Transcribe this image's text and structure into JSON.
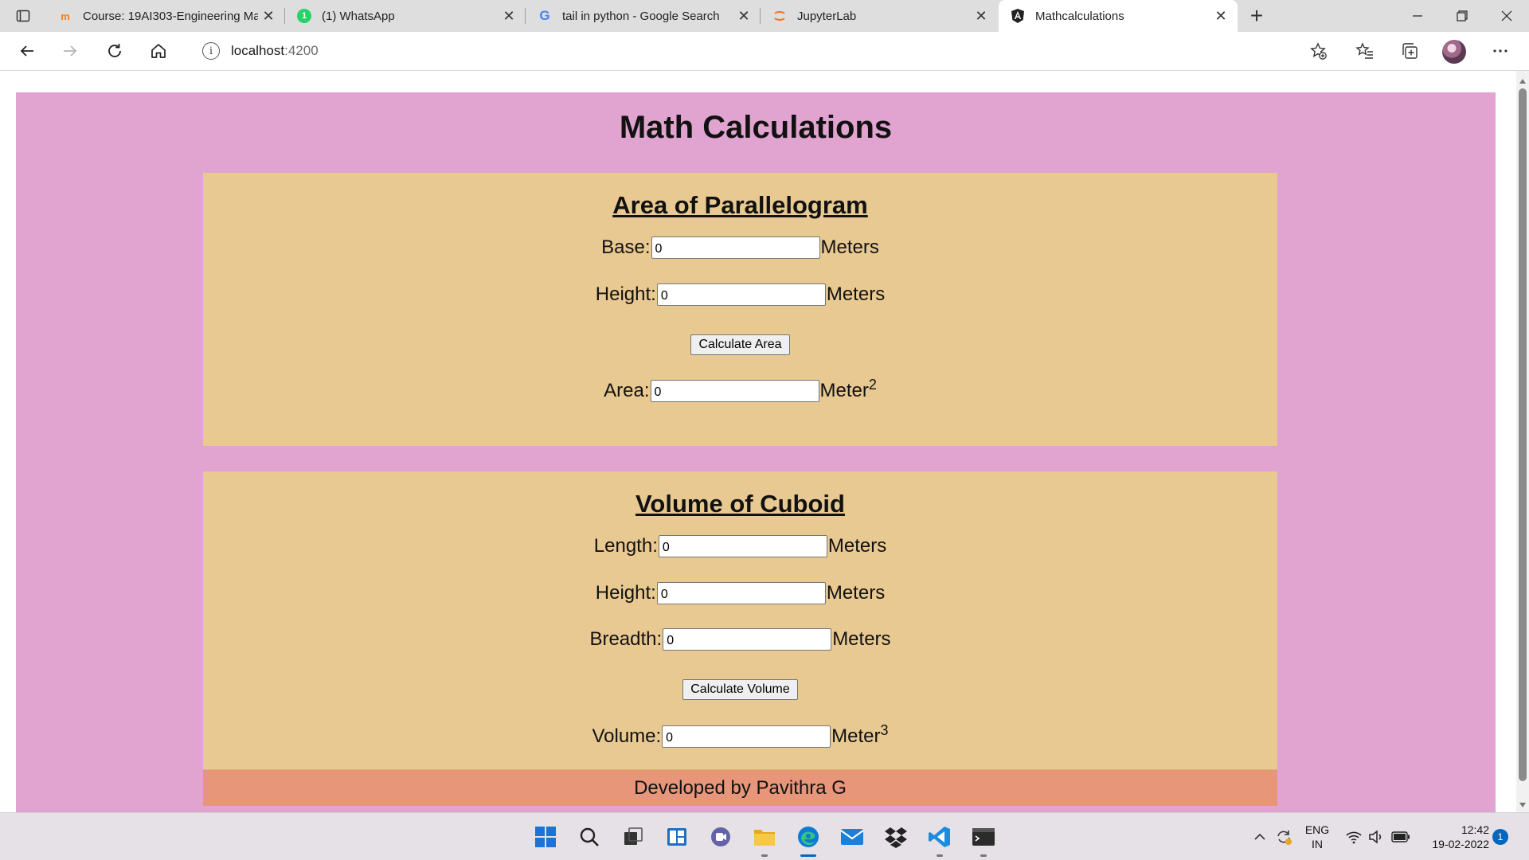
{
  "browser": {
    "tabs": [
      {
        "title": "Course: 19AI303-Engineering Mathematics",
        "favicon": "moodle-icon",
        "active": false
      },
      {
        "title": "(1) WhatsApp",
        "favicon": "whatsapp-icon",
        "active": false
      },
      {
        "title": "tail in python - Google Search",
        "favicon": "google-icon",
        "active": false
      },
      {
        "title": "JupyterLab",
        "favicon": "jupyter-icon",
        "active": false
      },
      {
        "title": "Mathcalculations",
        "favicon": "angular-icon",
        "active": true
      }
    ],
    "address": {
      "host": "localhost",
      "port": ":4200"
    }
  },
  "page": {
    "title": "Math Calculations",
    "parallelogram": {
      "heading": "Area of Parallelogram",
      "base_label": "Base:",
      "base_value": "0",
      "height_label": "Height:",
      "height_value": "0",
      "unit": "Meters",
      "button": "Calculate Area",
      "area_label": "Area:",
      "area_value": "0",
      "area_unit": "Meter",
      "area_exp": "2"
    },
    "cuboid": {
      "heading": "Volume of Cuboid",
      "length_label": "Length:",
      "length_value": "0",
      "height_label": "Height:",
      "height_value": "0",
      "breadth_label": "Breadth:",
      "breadth_value": "0",
      "unit": "Meters",
      "button": "Calculate Volume",
      "volume_label": "Volume:",
      "volume_value": "0",
      "volume_unit": "Meter",
      "volume_exp": "3"
    },
    "footer": "Developed by Pavithra G"
  },
  "taskbar": {
    "apps": [
      "windows-start-icon",
      "search-icon",
      "task-view-icon",
      "widgets-icon",
      "teams-chat-icon",
      "file-explorer-icon",
      "edge-icon",
      "mail-icon",
      "dropbox-icon",
      "vscode-icon",
      "terminal-icon"
    ],
    "lang_line1": "ENG",
    "lang_line2": "IN",
    "time": "12:42",
    "date": "19-02-2022",
    "notifications": "1"
  },
  "colors": {
    "page_background": "#e1a3cf",
    "card_background": "#e8c991",
    "footer_background": "#e89679"
  }
}
